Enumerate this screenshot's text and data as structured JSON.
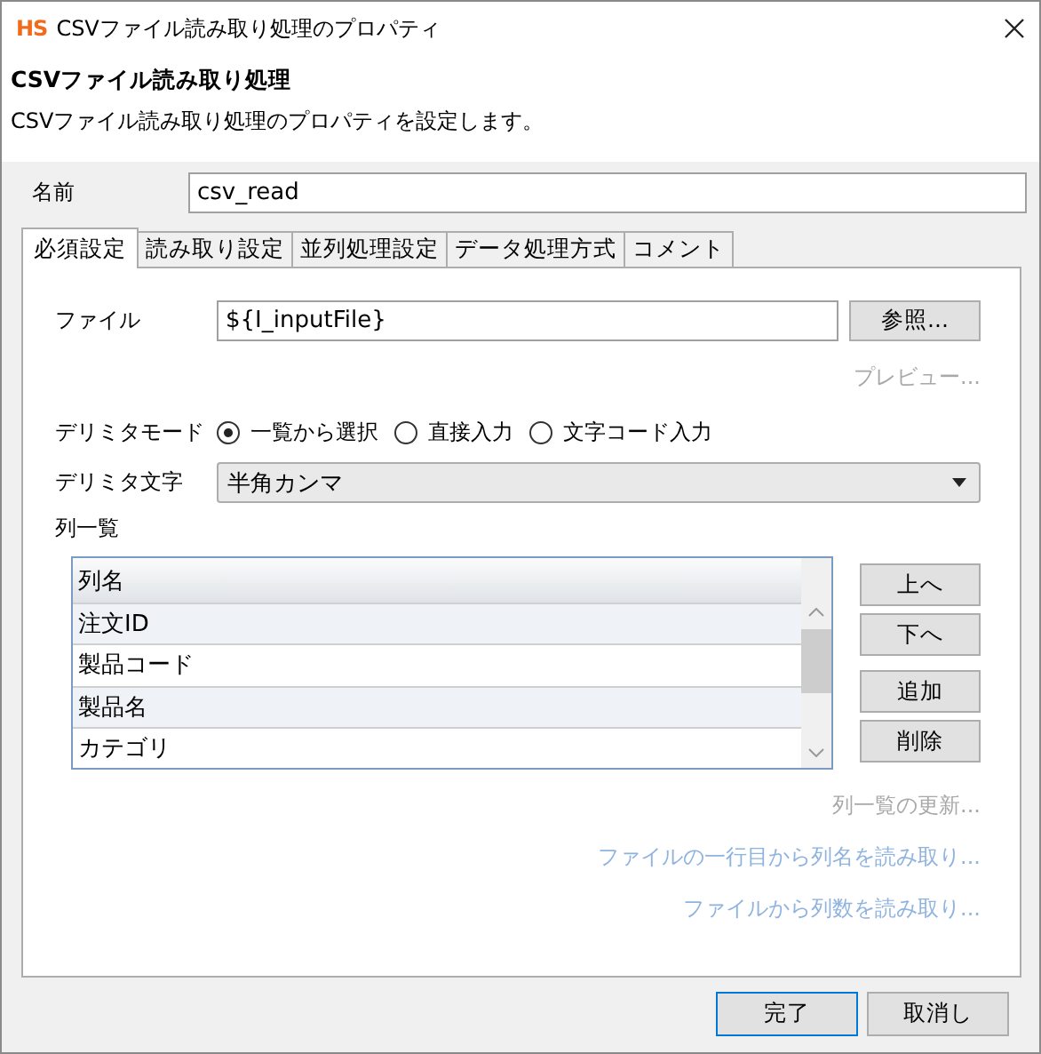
{
  "window": {
    "icon_text": "HS",
    "title": "CSVファイル読み取り処理のプロパティ"
  },
  "header": {
    "title": "CSVファイル読み取り処理",
    "description": "CSVファイル読み取り処理のプロパティを設定します。"
  },
  "name_field": {
    "label": "名前",
    "value": "csv_read"
  },
  "tabs": [
    {
      "label": "必須設定",
      "selected": true
    },
    {
      "label": "読み取り設定",
      "selected": false
    },
    {
      "label": "並列処理設定",
      "selected": false
    },
    {
      "label": "データ処理方式",
      "selected": false
    },
    {
      "label": "コメント",
      "selected": false
    }
  ],
  "file": {
    "label": "ファイル",
    "value": "${I_inputFile}",
    "button": "参照..."
  },
  "preview_link": {
    "label": "プレビュー...",
    "disabled": true
  },
  "delimiter_mode": {
    "label": "デリミタモード",
    "options": [
      {
        "label": "一覧から選択",
        "selected": true
      },
      {
        "label": "直接入力",
        "selected": false
      },
      {
        "label": "文字コード入力",
        "selected": false
      }
    ]
  },
  "delimiter_char": {
    "label": "デリミタ文字",
    "value": "半角カンマ"
  },
  "column_list": {
    "label": "列一覧",
    "header": "列名",
    "rows": [
      "注文ID",
      "製品コード",
      "製品名",
      "カテゴリ"
    ],
    "buttons": [
      "上へ",
      "下へ",
      "追加",
      "削除"
    ]
  },
  "links": [
    {
      "label": "列一覧の更新...",
      "disabled": true
    },
    {
      "label": "ファイルの一行目から列名を読み取り...",
      "disabled": false
    },
    {
      "label": "ファイルから列数を読み取り...",
      "disabled": false
    }
  ],
  "buttons": [
    {
      "label": "完了",
      "default": true
    },
    {
      "label": "取消し",
      "default": false
    }
  ]
}
